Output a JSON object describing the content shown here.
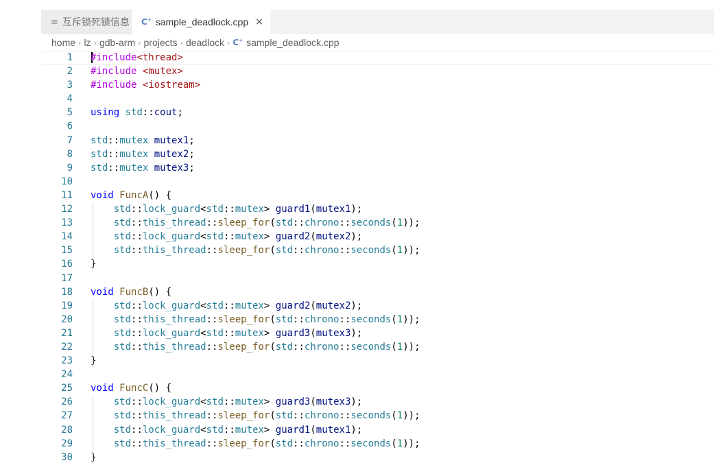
{
  "tabs": [
    {
      "label": "互斥锁死锁信息",
      "icon": "preview-icon",
      "active": false
    },
    {
      "label": "sample_deadlock.cpp",
      "icon": "cpp-file-icon",
      "active": true,
      "close": "×"
    }
  ],
  "breadcrumb": {
    "items": [
      "home",
      "lz",
      "gdb-arm",
      "projects",
      "deadlock"
    ],
    "file": "sample_deadlock.cpp",
    "separator": "›"
  },
  "code_lines": [
    {
      "n": "1",
      "tokens": [
        [
          "pp",
          "#include"
        ],
        [
          "str",
          "<thread>"
        ]
      ]
    },
    {
      "n": "2",
      "tokens": [
        [
          "pp",
          "#include "
        ],
        [
          "str",
          "<mutex>"
        ]
      ]
    },
    {
      "n": "3",
      "tokens": [
        [
          "pp",
          "#include "
        ],
        [
          "str",
          "<iostream>"
        ]
      ]
    },
    {
      "n": "4",
      "tokens": []
    },
    {
      "n": "5",
      "tokens": [
        [
          "kw",
          "using "
        ],
        [
          "ns",
          "std"
        ],
        [
          "p",
          "::"
        ],
        [
          "var",
          "cout"
        ],
        [
          "p",
          ";"
        ]
      ]
    },
    {
      "n": "6",
      "tokens": []
    },
    {
      "n": "7",
      "tokens": [
        [
          "ns",
          "std"
        ],
        [
          "p",
          "::"
        ],
        [
          "ty",
          "mutex "
        ],
        [
          "var",
          "mutex1"
        ],
        [
          "p",
          ";"
        ]
      ]
    },
    {
      "n": "8",
      "tokens": [
        [
          "ns",
          "std"
        ],
        [
          "p",
          "::"
        ],
        [
          "ty",
          "mutex "
        ],
        [
          "var",
          "mutex2"
        ],
        [
          "p",
          ";"
        ]
      ]
    },
    {
      "n": "9",
      "tokens": [
        [
          "ns",
          "std"
        ],
        [
          "p",
          "::"
        ],
        [
          "ty",
          "mutex "
        ],
        [
          "var",
          "mutex3"
        ],
        [
          "p",
          ";"
        ]
      ]
    },
    {
      "n": "10",
      "tokens": []
    },
    {
      "n": "11",
      "tokens": [
        [
          "kw",
          "void "
        ],
        [
          "fn",
          "FuncA"
        ],
        [
          "p",
          "() {"
        ]
      ]
    },
    {
      "n": "12",
      "tokens": [
        [
          "p",
          "    "
        ],
        [
          "ns",
          "std"
        ],
        [
          "p",
          "::"
        ],
        [
          "ty",
          "lock_guard"
        ],
        [
          "p",
          "<"
        ],
        [
          "ns",
          "std"
        ],
        [
          "p",
          "::"
        ],
        [
          "ty",
          "mutex"
        ],
        [
          "p",
          "> "
        ],
        [
          "var",
          "guard1"
        ],
        [
          "p",
          "("
        ],
        [
          "var",
          "mutex1"
        ],
        [
          "p",
          ");"
        ]
      ]
    },
    {
      "n": "13",
      "tokens": [
        [
          "p",
          "    "
        ],
        [
          "ns",
          "std"
        ],
        [
          "p",
          "::"
        ],
        [
          "ns",
          "this_thread"
        ],
        [
          "p",
          "::"
        ],
        [
          "fn",
          "sleep_for"
        ],
        [
          "p",
          "("
        ],
        [
          "ns",
          "std"
        ],
        [
          "p",
          "::"
        ],
        [
          "ns",
          "chrono"
        ],
        [
          "p",
          "::"
        ],
        [
          "ty",
          "seconds"
        ],
        [
          "p",
          "("
        ],
        [
          "num",
          "1"
        ],
        [
          "p",
          "));"
        ]
      ]
    },
    {
      "n": "14",
      "tokens": [
        [
          "p",
          "    "
        ],
        [
          "ns",
          "std"
        ],
        [
          "p",
          "::"
        ],
        [
          "ty",
          "lock_guard"
        ],
        [
          "p",
          "<"
        ],
        [
          "ns",
          "std"
        ],
        [
          "p",
          "::"
        ],
        [
          "ty",
          "mutex"
        ],
        [
          "p",
          "> "
        ],
        [
          "var",
          "guard2"
        ],
        [
          "p",
          "("
        ],
        [
          "var",
          "mutex2"
        ],
        [
          "p",
          ");"
        ]
      ]
    },
    {
      "n": "15",
      "tokens": [
        [
          "p",
          "    "
        ],
        [
          "ns",
          "std"
        ],
        [
          "p",
          "::"
        ],
        [
          "ns",
          "this_thread"
        ],
        [
          "p",
          "::"
        ],
        [
          "fn",
          "sleep_for"
        ],
        [
          "p",
          "("
        ],
        [
          "ns",
          "std"
        ],
        [
          "p",
          "::"
        ],
        [
          "ns",
          "chrono"
        ],
        [
          "p",
          "::"
        ],
        [
          "ty",
          "seconds"
        ],
        [
          "p",
          "("
        ],
        [
          "num",
          "1"
        ],
        [
          "p",
          "));"
        ]
      ]
    },
    {
      "n": "16",
      "tokens": [
        [
          "p",
          "}"
        ]
      ]
    },
    {
      "n": "17",
      "tokens": []
    },
    {
      "n": "18",
      "tokens": [
        [
          "kw",
          "void "
        ],
        [
          "fn",
          "FuncB"
        ],
        [
          "p",
          "() {"
        ]
      ]
    },
    {
      "n": "19",
      "tokens": [
        [
          "p",
          "    "
        ],
        [
          "ns",
          "std"
        ],
        [
          "p",
          "::"
        ],
        [
          "ty",
          "lock_guard"
        ],
        [
          "p",
          "<"
        ],
        [
          "ns",
          "std"
        ],
        [
          "p",
          "::"
        ],
        [
          "ty",
          "mutex"
        ],
        [
          "p",
          "> "
        ],
        [
          "var",
          "guard2"
        ],
        [
          "p",
          "("
        ],
        [
          "var",
          "mutex2"
        ],
        [
          "p",
          ");"
        ]
      ]
    },
    {
      "n": "20",
      "tokens": [
        [
          "p",
          "    "
        ],
        [
          "ns",
          "std"
        ],
        [
          "p",
          "::"
        ],
        [
          "ns",
          "this_thread"
        ],
        [
          "p",
          "::"
        ],
        [
          "fn",
          "sleep_for"
        ],
        [
          "p",
          "("
        ],
        [
          "ns",
          "std"
        ],
        [
          "p",
          "::"
        ],
        [
          "ns",
          "chrono"
        ],
        [
          "p",
          "::"
        ],
        [
          "ty",
          "seconds"
        ],
        [
          "p",
          "("
        ],
        [
          "num",
          "1"
        ],
        [
          "p",
          "));"
        ]
      ]
    },
    {
      "n": "21",
      "tokens": [
        [
          "p",
          "    "
        ],
        [
          "ns",
          "std"
        ],
        [
          "p",
          "::"
        ],
        [
          "ty",
          "lock_guard"
        ],
        [
          "p",
          "<"
        ],
        [
          "ns",
          "std"
        ],
        [
          "p",
          "::"
        ],
        [
          "ty",
          "mutex"
        ],
        [
          "p",
          "> "
        ],
        [
          "var",
          "guard3"
        ],
        [
          "p",
          "("
        ],
        [
          "var",
          "mutex3"
        ],
        [
          "p",
          ");"
        ]
      ]
    },
    {
      "n": "22",
      "tokens": [
        [
          "p",
          "    "
        ],
        [
          "ns",
          "std"
        ],
        [
          "p",
          "::"
        ],
        [
          "ns",
          "this_thread"
        ],
        [
          "p",
          "::"
        ],
        [
          "fn",
          "sleep_for"
        ],
        [
          "p",
          "("
        ],
        [
          "ns",
          "std"
        ],
        [
          "p",
          "::"
        ],
        [
          "ns",
          "chrono"
        ],
        [
          "p",
          "::"
        ],
        [
          "ty",
          "seconds"
        ],
        [
          "p",
          "("
        ],
        [
          "num",
          "1"
        ],
        [
          "p",
          "));"
        ]
      ]
    },
    {
      "n": "23",
      "tokens": [
        [
          "p",
          "}"
        ]
      ]
    },
    {
      "n": "24",
      "tokens": []
    },
    {
      "n": "25",
      "tokens": [
        [
          "kw",
          "void "
        ],
        [
          "fn",
          "FuncC"
        ],
        [
          "p",
          "() {"
        ]
      ]
    },
    {
      "n": "26",
      "tokens": [
        [
          "p",
          "    "
        ],
        [
          "ns",
          "std"
        ],
        [
          "p",
          "::"
        ],
        [
          "ty",
          "lock_guard"
        ],
        [
          "p",
          "<"
        ],
        [
          "ns",
          "std"
        ],
        [
          "p",
          "::"
        ],
        [
          "ty",
          "mutex"
        ],
        [
          "p",
          "> "
        ],
        [
          "var",
          "guard3"
        ],
        [
          "p",
          "("
        ],
        [
          "var",
          "mutex3"
        ],
        [
          "p",
          ");"
        ]
      ]
    },
    {
      "n": "27",
      "tokens": [
        [
          "p",
          "    "
        ],
        [
          "ns",
          "std"
        ],
        [
          "p",
          "::"
        ],
        [
          "ns",
          "this_thread"
        ],
        [
          "p",
          "::"
        ],
        [
          "fn",
          "sleep_for"
        ],
        [
          "p",
          "("
        ],
        [
          "ns",
          "std"
        ],
        [
          "p",
          "::"
        ],
        [
          "ns",
          "chrono"
        ],
        [
          "p",
          "::"
        ],
        [
          "ty",
          "seconds"
        ],
        [
          "p",
          "("
        ],
        [
          "num",
          "1"
        ],
        [
          "p",
          "));"
        ]
      ]
    },
    {
      "n": "28",
      "tokens": [
        [
          "p",
          "    "
        ],
        [
          "ns",
          "std"
        ],
        [
          "p",
          "::"
        ],
        [
          "ty",
          "lock_guard"
        ],
        [
          "p",
          "<"
        ],
        [
          "ns",
          "std"
        ],
        [
          "p",
          "::"
        ],
        [
          "ty",
          "mutex"
        ],
        [
          "p",
          "> "
        ],
        [
          "var",
          "guard1"
        ],
        [
          "p",
          "("
        ],
        [
          "var",
          "mutex1"
        ],
        [
          "p",
          ");"
        ]
      ]
    },
    {
      "n": "29",
      "tokens": [
        [
          "p",
          "    "
        ],
        [
          "ns",
          "std"
        ],
        [
          "p",
          "::"
        ],
        [
          "ns",
          "this_thread"
        ],
        [
          "p",
          "::"
        ],
        [
          "fn",
          "sleep_for"
        ],
        [
          "p",
          "("
        ],
        [
          "ns",
          "std"
        ],
        [
          "p",
          "::"
        ],
        [
          "ns",
          "chrono"
        ],
        [
          "p",
          "::"
        ],
        [
          "ty",
          "seconds"
        ],
        [
          "p",
          "("
        ],
        [
          "num",
          "1"
        ],
        [
          "p",
          "));"
        ]
      ]
    },
    {
      "n": "30",
      "tokens": [
        [
          "p",
          "}"
        ]
      ]
    }
  ],
  "colors": {
    "line_number": "#237893",
    "preprocessor": "#af00db",
    "string": "#a31515",
    "keyword": "#0000ff",
    "type": "#267f99",
    "variable": "#001080",
    "function": "#795e26",
    "number": "#098658"
  }
}
